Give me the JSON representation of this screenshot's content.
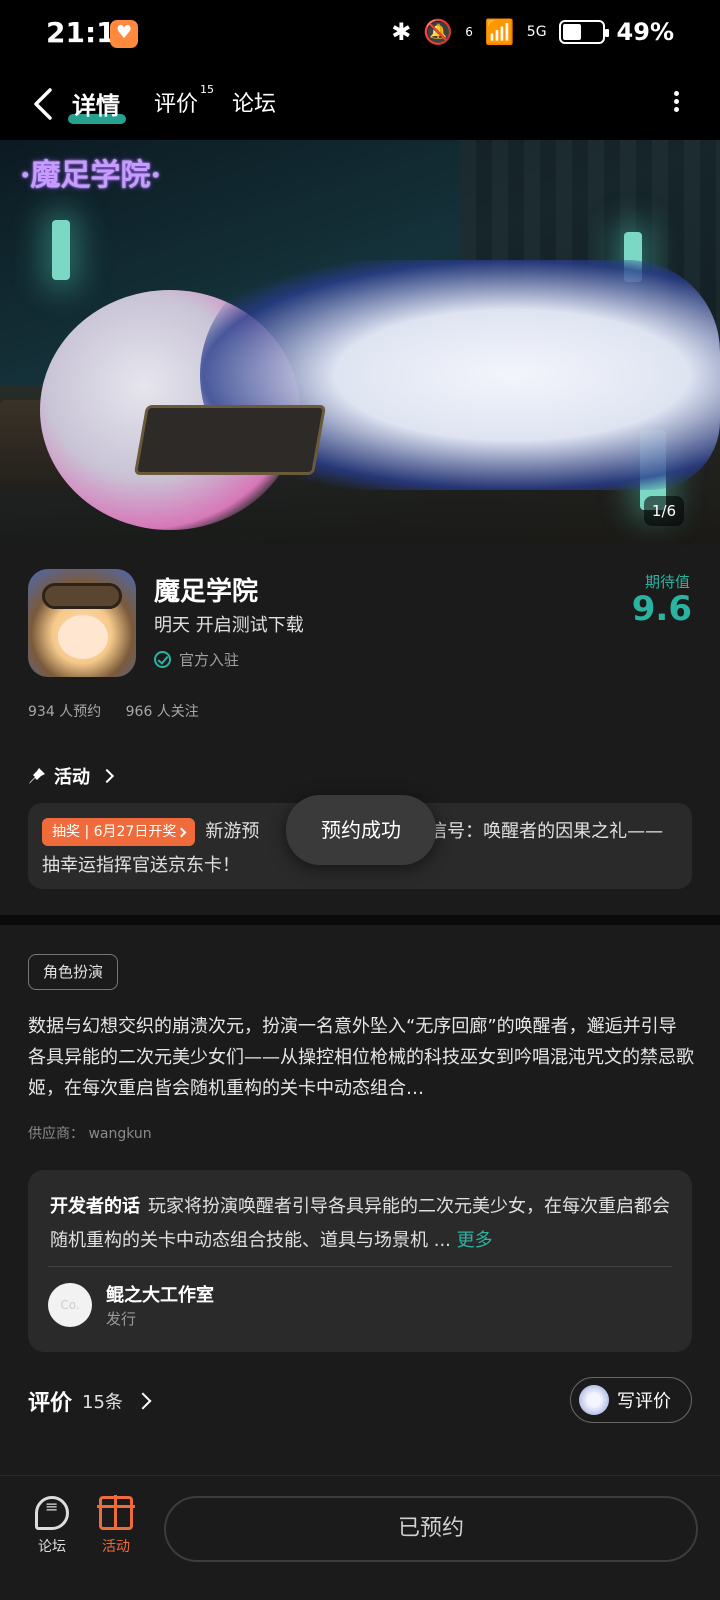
{
  "status_bar": {
    "time": "21:12",
    "network": "5G",
    "signal_label": "6",
    "battery": "49%"
  },
  "nav": {
    "tabs": [
      {
        "label": "详情",
        "active": true
      },
      {
        "label": "评价",
        "badge": "15"
      },
      {
        "label": "论坛"
      }
    ]
  },
  "hero": {
    "logo_text": "·魔足学院·",
    "page_indicator": "1/6"
  },
  "game": {
    "title": "魔足学院",
    "subtitle": "明天 开启测试下载",
    "official_label": "官方入驻",
    "expect_label": "期待值",
    "expect_value": "9.6",
    "reservations": "934 人预约",
    "followers": "966 人关注"
  },
  "activity": {
    "heading": "活动",
    "tag": "抽奖 | 6月27日开奖",
    "text_before": "新游预",
    "text_after": "作 无序信号：唤醒者的因果之礼——抽幸运指挥官送京东卡！"
  },
  "toast": "预约成功",
  "description": {
    "genre": "角色扮演",
    "text": "数据与幻想交织的崩溃次元，扮演一名意外坠入“无序回廊”的唤醒者，邂逅并引导各具异能的二次元美少女们——从操控相位枪械的科技巫女到吟唱混沌咒文的禁忌歌姬，在每次重启皆会随机重构的关卡中动态组合…",
    "supplier": "供应商： wangkun"
  },
  "developer": {
    "label": "开发者的话",
    "text": "玩家将扮演唤醒者引导各具异能的二次元美少女，在每次重启都会随机重构的关卡中动态组合技能、道具与场景机 ...",
    "more": "更多",
    "avatar_text": "Co.",
    "studio": "鲲之大工作室",
    "role": "发行"
  },
  "reviews": {
    "label": "评价",
    "count": "15条",
    "write_label": "写评价"
  },
  "bottom_bar": {
    "forum_label": "论坛",
    "activity_label": "活动",
    "reserved_label": "已预约"
  },
  "colors": {
    "accent": "#2ab3a0",
    "orange": "#ef6b3b",
    "background": "#1b1b1b"
  }
}
